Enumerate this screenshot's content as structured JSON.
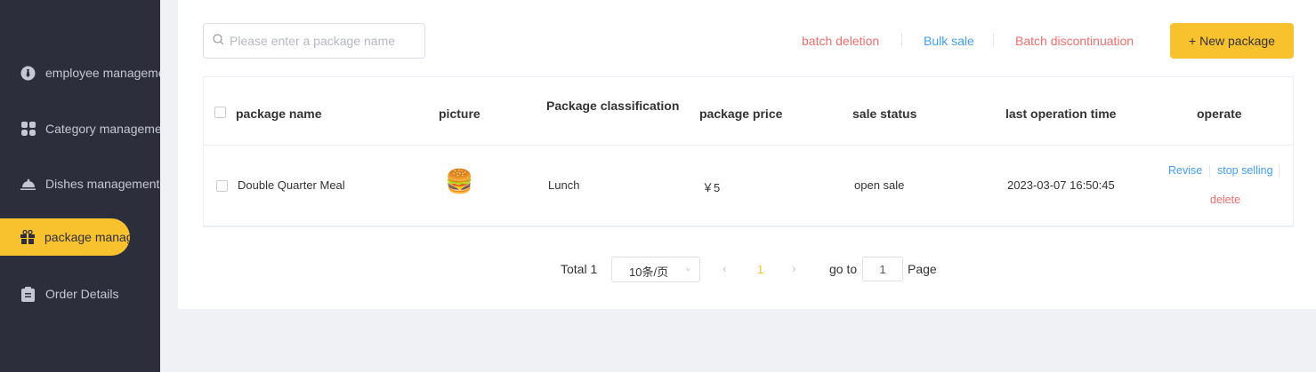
{
  "sidebar": {
    "items": [
      {
        "label": "employee management",
        "icon": "employee-icon"
      },
      {
        "label": "Category management",
        "icon": "category-icon"
      },
      {
        "label": "Dishes management",
        "icon": "dishes-icon"
      },
      {
        "label": "package management",
        "icon": "gift-icon",
        "active": true
      },
      {
        "label": "Order Details",
        "icon": "clipboard-icon"
      }
    ]
  },
  "toolbar": {
    "search_placeholder": "Please enter a package name",
    "batch_deletion": "batch deletion",
    "bulk_sale": "Bulk sale",
    "batch_discontinuation": "Batch discontinuation",
    "new_package": "+ New package"
  },
  "table": {
    "headers": [
      "package name",
      "picture",
      "Package classification",
      "package price",
      "sale status",
      "last operation time",
      "operate"
    ],
    "rows": [
      {
        "name": "Double Quarter Meal",
        "picture": "🍔",
        "classification": "Lunch",
        "price": "￥5",
        "status": "open sale",
        "time": "2023-03-07 16:50:45",
        "actions": {
          "revise": "Revise",
          "stop": "stop selling",
          "delete": "delete"
        }
      }
    ]
  },
  "pagination": {
    "total": "Total 1",
    "page_size": "10条/页",
    "current": "1",
    "goto_label": "go to",
    "goto_value": "1",
    "page_label": "Page"
  },
  "colors": {
    "accent": "#f8c12e",
    "danger": "#f56c6c",
    "link": "#409eff"
  }
}
